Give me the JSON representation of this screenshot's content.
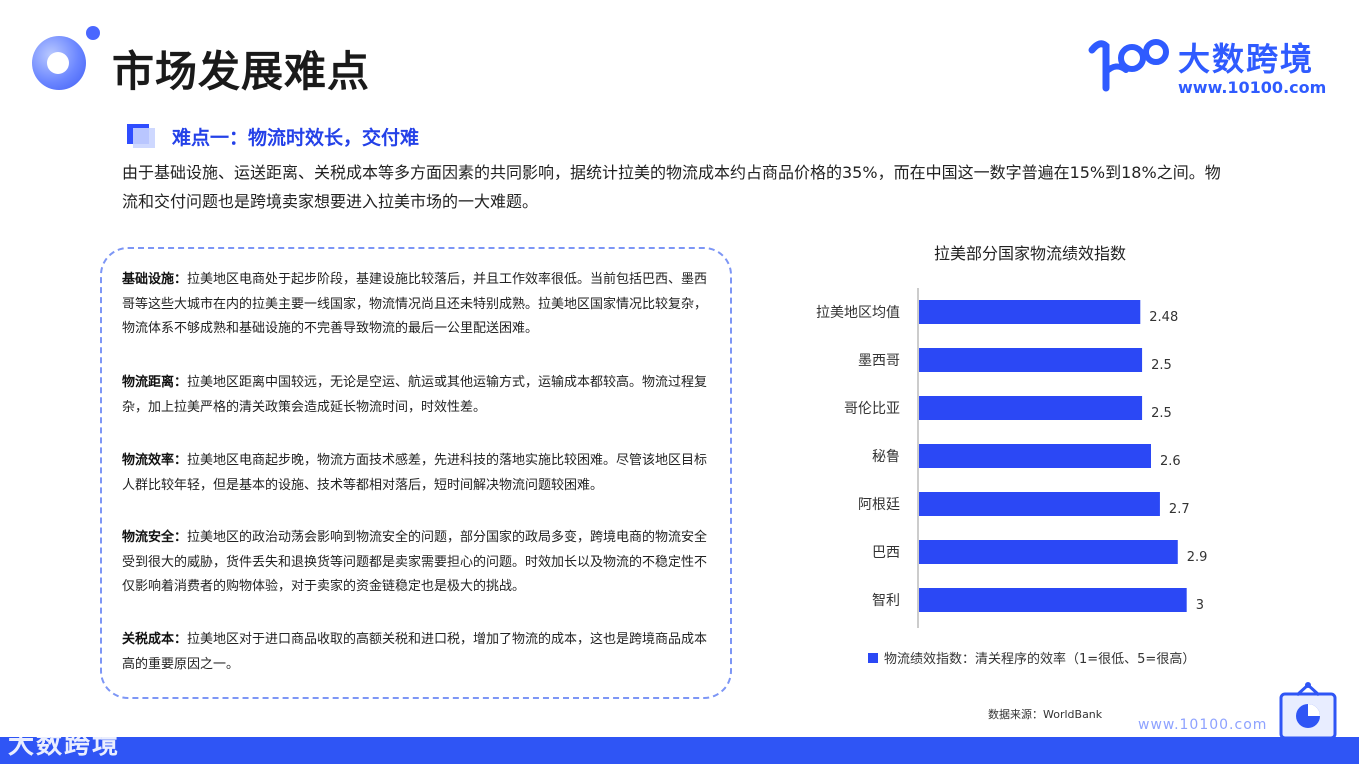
{
  "page": {
    "title": "市场发展难点"
  },
  "brand": {
    "name": "大数跨境",
    "url": "www.10100.com",
    "color": "#2f5bff",
    "footer_url": "www.10100.com",
    "watermark": "大数跨境"
  },
  "section": {
    "title": "难点一：物流时效长，交付难",
    "intro": "由于基础设施、运送距离、关税成本等多方面因素的共同影响，据统计拉美的物流成本约占商品价格的35%，而在中国这一数字普遍在15%到18%之间。物流和交付问题也是跨境卖家想要进入拉美市场的一大难题。"
  },
  "difficulties": [
    {
      "label": "基础设施：",
      "text": "拉美地区电商处于起步阶段，基建设施比较落后，并且工作效率很低。当前包括巴西、墨西哥等这些大城市在内的拉美主要一线国家，物流情况尚且还未特别成熟。拉美地区国家情况比较复杂，物流体系不够成熟和基础设施的不完善导致物流的最后一公里配送困难。"
    },
    {
      "label": "物流距离：",
      "text": "拉美地区距离中国较远，无论是空运、航运或其他运输方式，运输成本都较高。物流过程复杂，加上拉美严格的清关政策会造成延长物流时间，时效性差。"
    },
    {
      "label": "物流效率：",
      "text": "拉美地区电商起步晚，物流方面技术感差，先进科技的落地实施比较困难。尽管该地区目标人群比较年轻，但是基本的设施、技术等都相对落后，短时间解决物流问题较困难。"
    },
    {
      "label": "物流安全：",
      "text": "拉美地区的政治动荡会影响到物流安全的问题，部分国家的政局多变，跨境电商的物流安全受到很大的威胁，货件丢失和退换货等问题都是卖家需要担心的问题。时效加长以及物流的不稳定性不仅影响着消费者的购物体验，对于卖家的资金链稳定也是极大的挑战。"
    },
    {
      "label": "关税成本：",
      "text": "拉美地区对于进口商品收取的高额关税和进口税，增加了物流的成本，这也是跨境商品成本高的重要原因之一。"
    }
  ],
  "chart_data": {
    "type": "bar",
    "orientation": "horizontal",
    "title": "拉美部分国家物流绩效指数",
    "categories": [
      "拉美地区均值",
      "墨西哥",
      "哥伦比亚",
      "秘鲁",
      "阿根廷",
      "巴西",
      "智利"
    ],
    "values": [
      2.48,
      2.5,
      2.5,
      2.6,
      2.7,
      2.9,
      3
    ],
    "value_labels": [
      "2.48",
      "2.5",
      "2.5",
      "2.6",
      "2.7",
      "2.9",
      "3"
    ],
    "series": [
      {
        "name": "物流绩效指数：清关程序的效率（1=很低、5=很高）",
        "color": "#2b48f5"
      }
    ],
    "xlim": [
      0,
      3.25
    ],
    "grid": false,
    "legend_position": "bottom",
    "source": "数据来源：WorldBank"
  }
}
